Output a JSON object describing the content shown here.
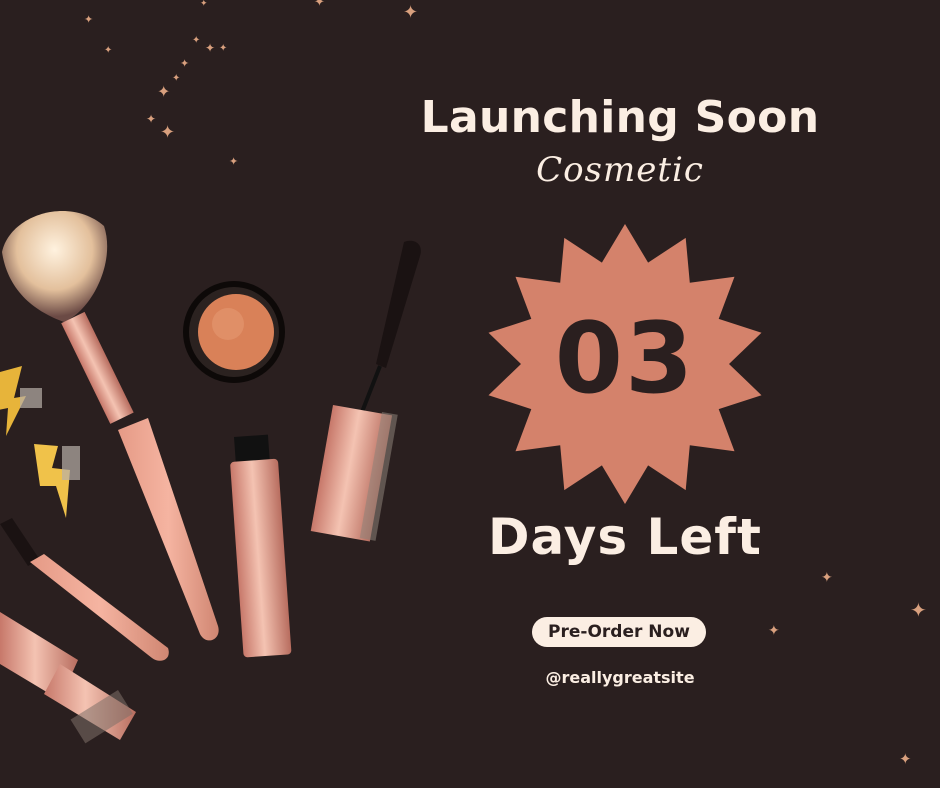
{
  "header": {
    "title": "Launching Soon",
    "subtitle": "Cosmetic"
  },
  "countdown": {
    "number": "03",
    "label": "Days Left"
  },
  "cta": {
    "label": "Pre-Order Now"
  },
  "footer": {
    "handle": "@reallygreatsite"
  },
  "colors": {
    "background": "#2a1f1f",
    "accent": "#d4826b",
    "text": "#fbeee3",
    "rose_gold": "#e8a48f",
    "star": "#d9a07e"
  },
  "icons": [
    "makeup-brush-icon",
    "blush-compact-icon",
    "mascara-icon",
    "lipstick-icon",
    "lightning-clip-icon",
    "star-icon"
  ]
}
